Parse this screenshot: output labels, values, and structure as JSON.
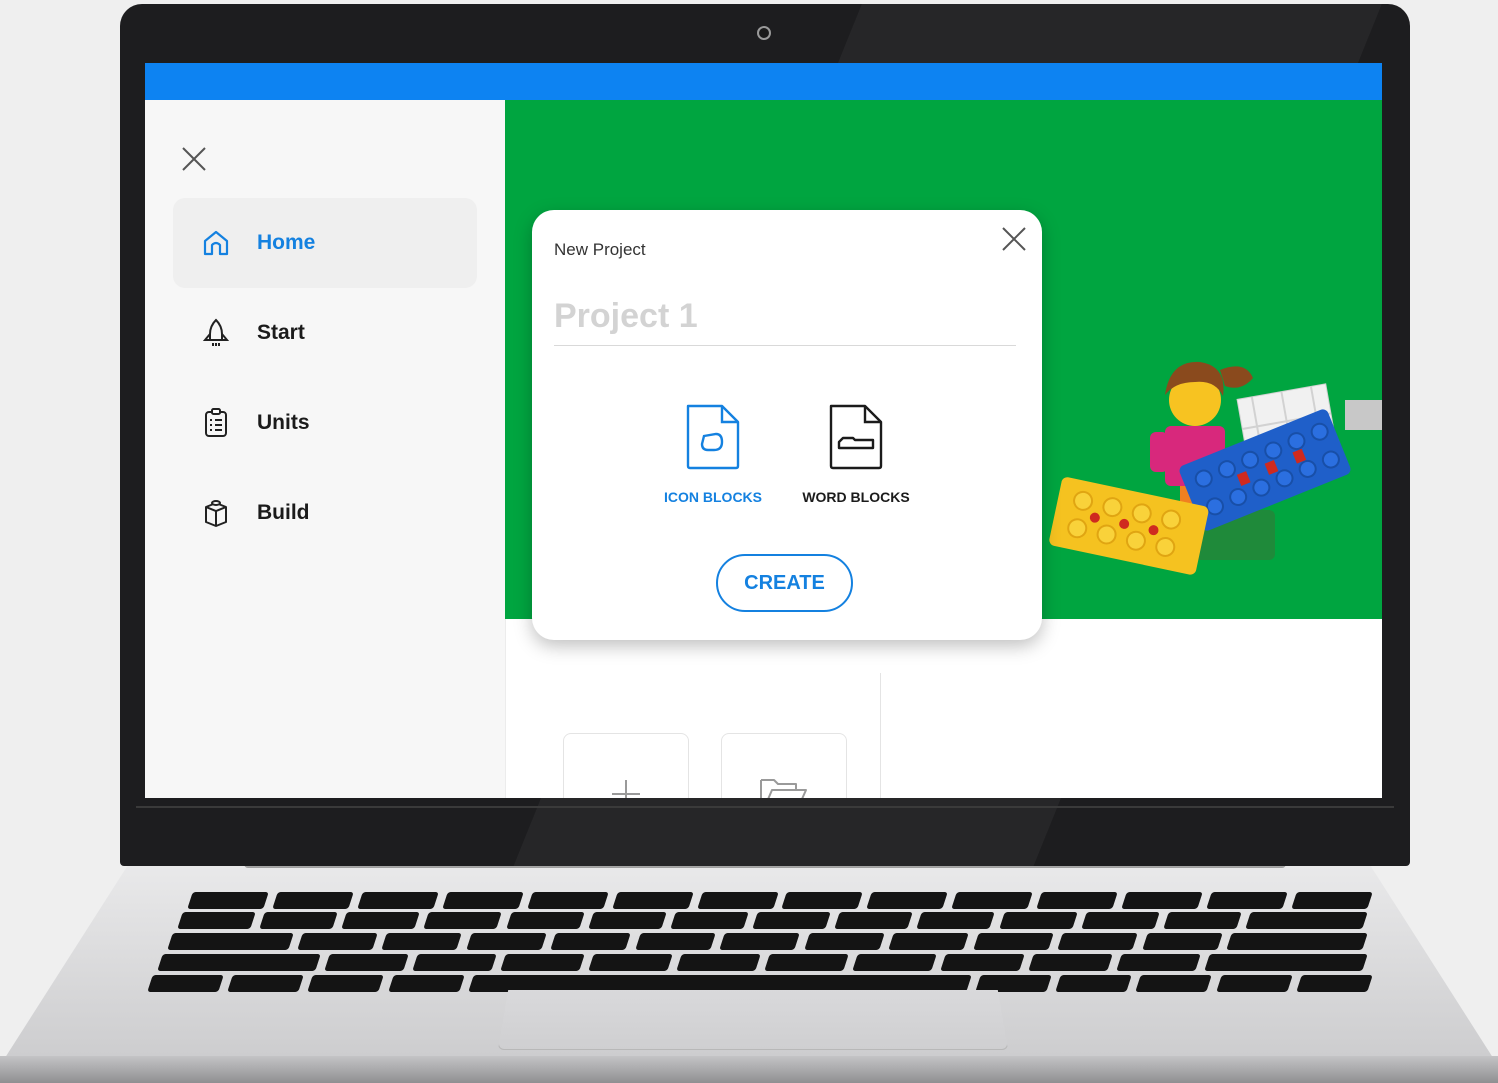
{
  "sidebar": {
    "close_icon": "close-icon",
    "items": [
      {
        "label": "Home",
        "icon": "home-icon",
        "active": true
      },
      {
        "label": "Start",
        "icon": "rocket-icon",
        "active": false
      },
      {
        "label": "Units",
        "icon": "clipboard-icon",
        "active": false
      },
      {
        "label": "Build",
        "icon": "brick-icon",
        "active": false
      }
    ]
  },
  "hero": {
    "background_color": "#00a540",
    "text_fragment_1": "n",
    "text_fragment_2": "l"
  },
  "modal": {
    "title": "New Project",
    "project_name_placeholder": "Project 1",
    "options": [
      {
        "label": "ICON BLOCKS",
        "icon": "icon-blocks-file-icon",
        "selected": true
      },
      {
        "label": "WORD BLOCKS",
        "icon": "word-blocks-file-icon",
        "selected": false
      }
    ],
    "create_label": "CREATE"
  },
  "tiles": [
    {
      "icon": "plus-icon"
    },
    {
      "icon": "folder-open-icon"
    }
  ],
  "colors": {
    "accent": "#1481e0",
    "topbar": "#0d83f2"
  }
}
